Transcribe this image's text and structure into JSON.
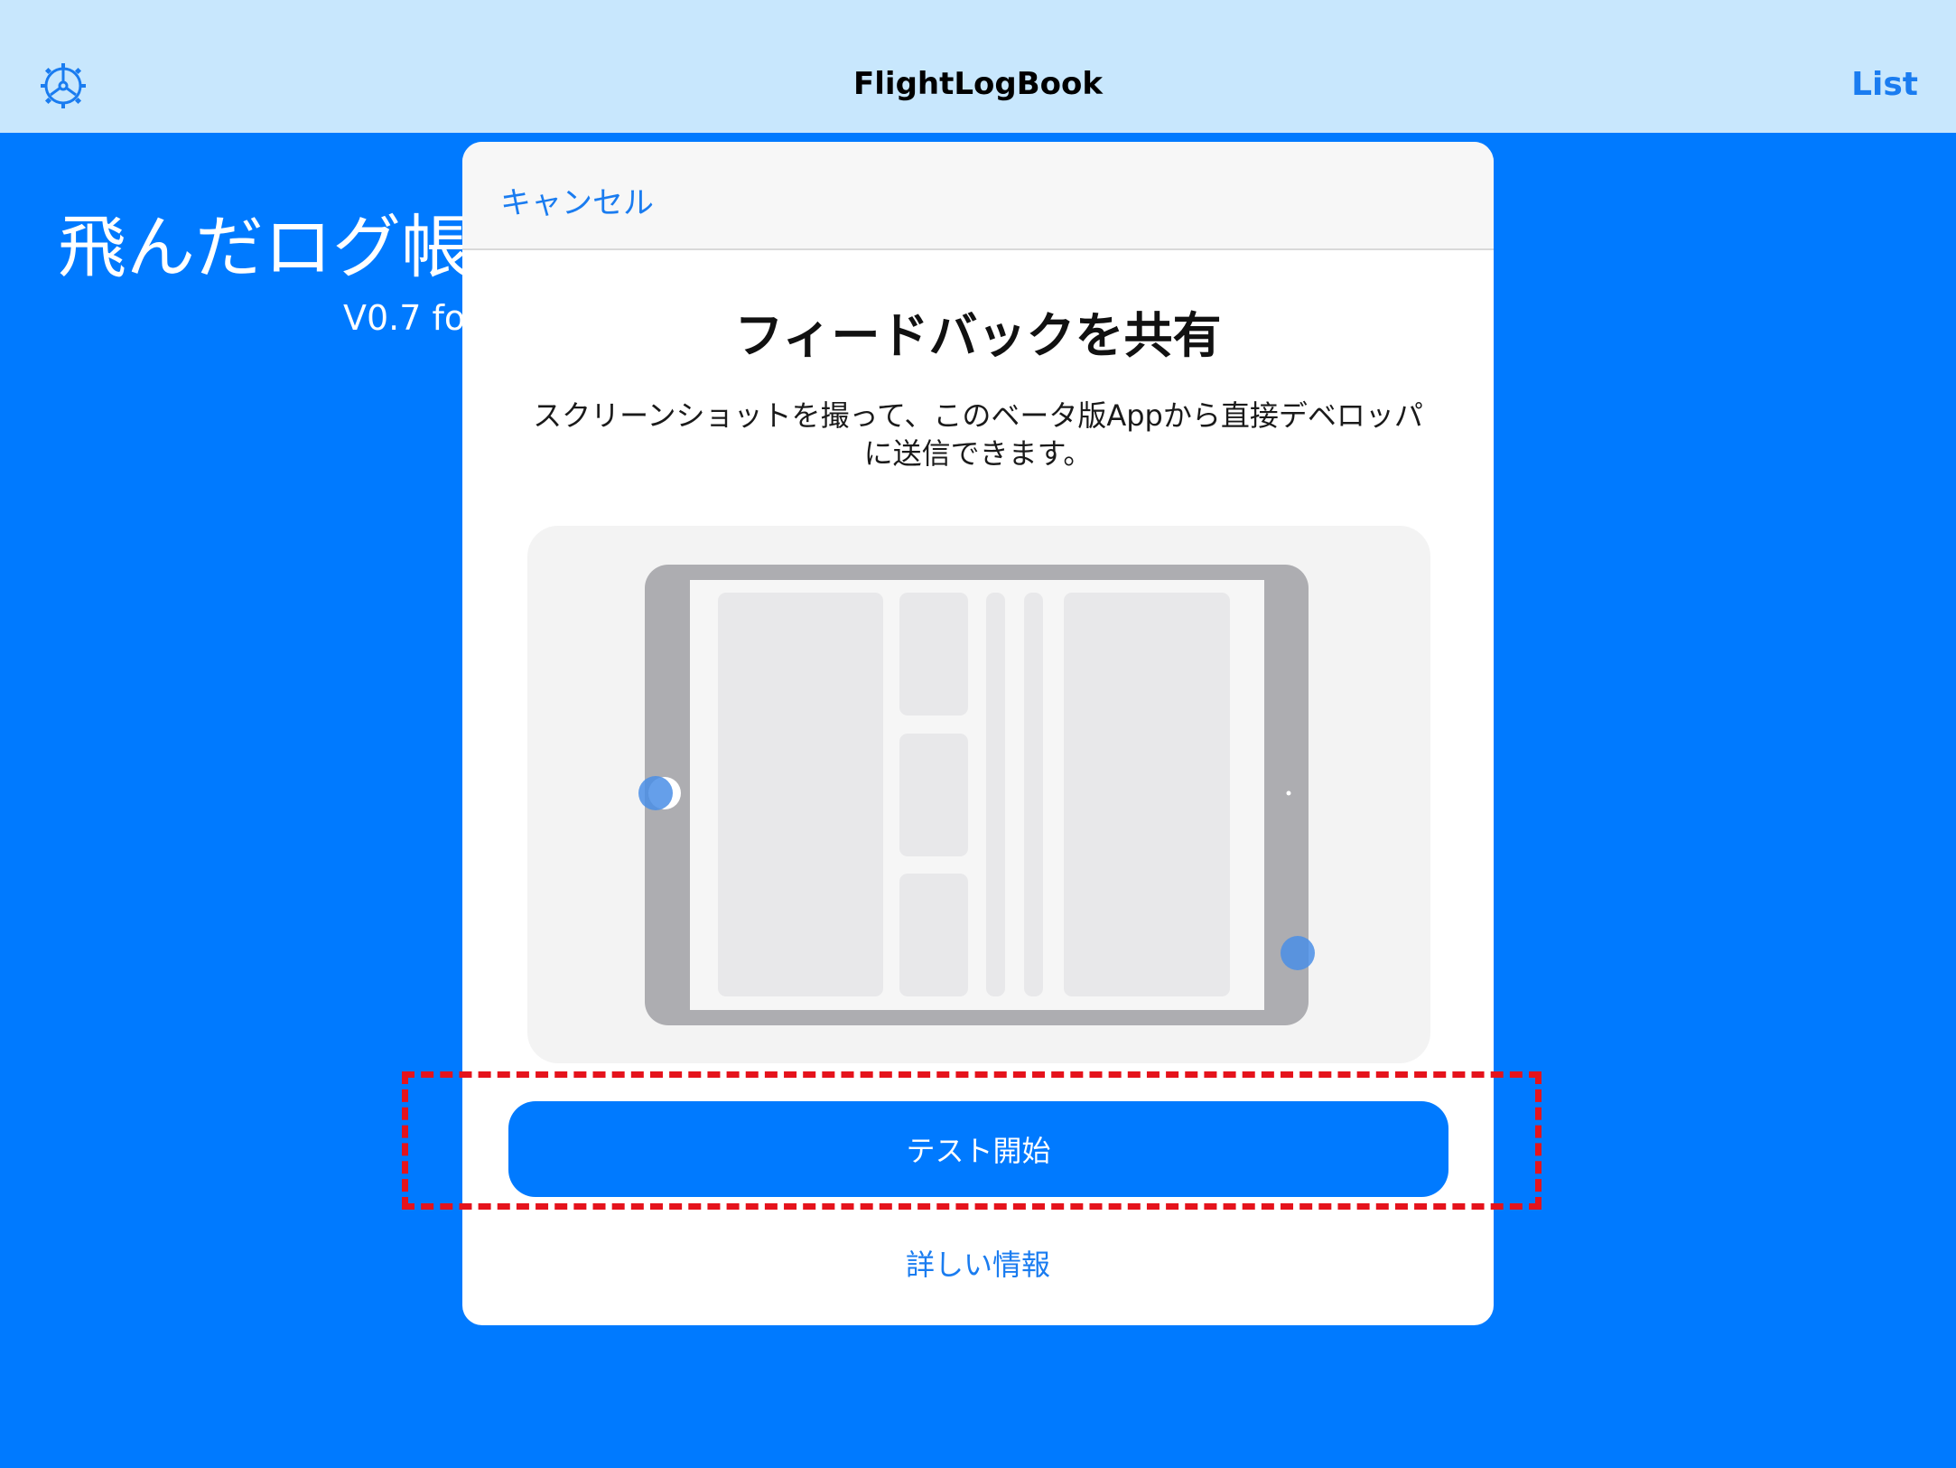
{
  "navbar": {
    "title": "FlightLogBook",
    "settings_icon": "gear-icon",
    "right_button_label": "List"
  },
  "background": {
    "title": "飛んだログ帳",
    "version": "V0.7 fo"
  },
  "sheet": {
    "cancel_label": "キャンセル",
    "heading": "フィードバックを共有",
    "description": "スクリーンショットを撮って、このベータ版Appから直接デベロッパに送信できます。",
    "illustration": "ipad-screenshot-gesture-illustration",
    "start_button_label": "テスト開始",
    "more_info_label": "詳しい情報"
  },
  "colors": {
    "background": "#007aff",
    "navbar": "#c8e7fd",
    "accent": "#1a7cf0",
    "highlight": "#e5131c"
  }
}
